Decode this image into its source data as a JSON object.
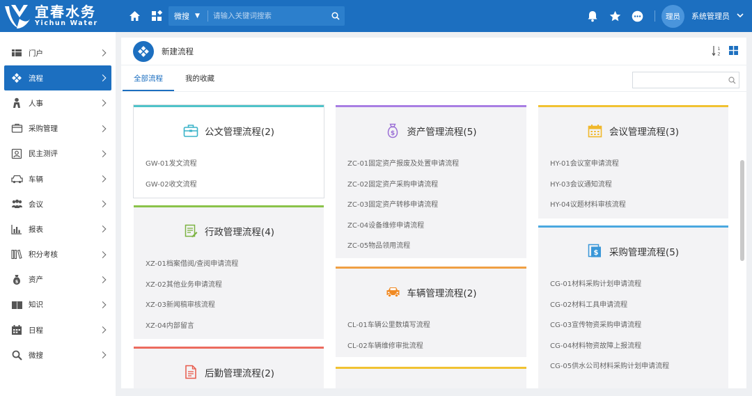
{
  "app": {
    "logo_cn": "宜春水务",
    "logo_en": "Yichun Water"
  },
  "topbar": {
    "search_scope": "微搜",
    "search_placeholder": "请输入关键词搜索",
    "avatar_text": "理员",
    "user_name": "系统管理员"
  },
  "sidebar": {
    "items": [
      {
        "label": "门户",
        "icon": "portal-icon"
      },
      {
        "label": "流程",
        "icon": "workflow-icon",
        "active": true
      },
      {
        "label": "人事",
        "icon": "person-icon"
      },
      {
        "label": "采购管理",
        "icon": "purchase-icon"
      },
      {
        "label": "民主测评",
        "icon": "evaluation-icon"
      },
      {
        "label": "车辆",
        "icon": "car-icon"
      },
      {
        "label": "会议",
        "icon": "meeting-icon"
      },
      {
        "label": "报表",
        "icon": "report-icon"
      },
      {
        "label": "积分考核",
        "icon": "books-icon"
      },
      {
        "label": "资产",
        "icon": "moneybag-icon"
      },
      {
        "label": "知识",
        "icon": "book-icon"
      },
      {
        "label": "日程",
        "icon": "calendar-icon"
      },
      {
        "label": "微搜",
        "icon": "search-icon"
      }
    ]
  },
  "main": {
    "title": "新建流程",
    "tabs": [
      {
        "label": "全部流程",
        "active": true
      },
      {
        "label": "我的收藏"
      }
    ]
  },
  "cards": {
    "gongwen": {
      "title": "公文管理流程(2)",
      "color": "#4fc3c9",
      "items": [
        "GW-01发文流程",
        "GW-02收文流程"
      ]
    },
    "zichan": {
      "title": "资产管理流程(5)",
      "color": "#a87ee3",
      "items": [
        "ZC-01固定资产报废及处置申请流程",
        "ZC-02固定资产采购申请流程",
        "ZC-03固定资产转移申请流程",
        "ZC-04设备维修申请流程",
        "ZC-05物品领用流程"
      ]
    },
    "huiyi": {
      "title": "会议管理流程(3)",
      "color": "#f1c232",
      "items": [
        "HY-01会议室申请流程",
        "HY-03会议通知流程",
        "HY-04议题材料审核流程"
      ]
    },
    "xingzheng": {
      "title": "行政管理流程(4)",
      "color": "#8bc34a",
      "items": [
        "XZ-01档案借阅/查阅申请流程",
        "XZ-02其他业务申请流程",
        "XZ-03新闻稿审核流程",
        "XZ-04内部留言"
      ]
    },
    "cheliang": {
      "title": "车辆管理流程(2)",
      "color": "#f0a043",
      "items": [
        "CL-01车辆公里数填写流程",
        "CL-02车辆维修审批流程"
      ]
    },
    "caigou": {
      "title": "采购管理流程(5)",
      "color": "#4aa8e0",
      "items": [
        "CG-01材料采购计划申请流程",
        "CG-02材料工具申请流程",
        "CG-03宣传物资采购申请流程",
        "CG-04材料物资故障上报流程",
        "CG-05供水公司材料采购计划申请流程"
      ]
    },
    "houqin": {
      "title": "后勤管理流程(2)",
      "color": "#ec6b5e",
      "items": []
    },
    "extra": {
      "color": "#f1c232"
    }
  }
}
